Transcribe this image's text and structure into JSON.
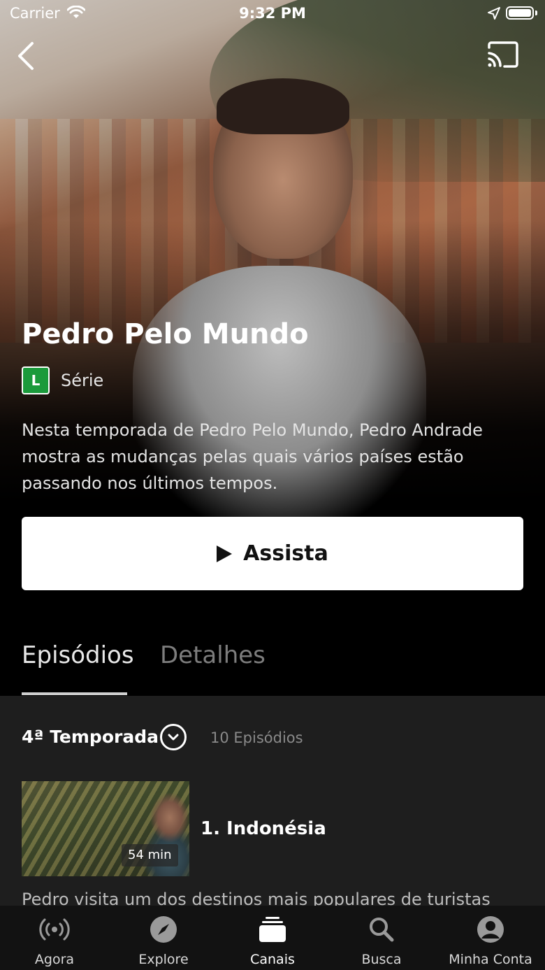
{
  "status_bar": {
    "carrier": "Carrier",
    "time": "9:32 PM"
  },
  "show": {
    "title": "Pedro Pelo Mundo",
    "rating": "L",
    "rating_color": "#1a9a3b",
    "type": "Série",
    "description": "Nesta temporada de Pedro Pelo Mundo, Pedro Andrade mostra as mudanças pelas quais vários países estão passando nos últimos tempos.",
    "watch_label": "Assista"
  },
  "tabs": {
    "episodes": "Episódios",
    "details": "Detalhes",
    "active": "episodes"
  },
  "season": {
    "label": "4ª Temporada",
    "episode_count": "10 Episódios"
  },
  "episodes": [
    {
      "title": "1. Indonésia",
      "duration": "54 min",
      "description": "Pedro visita um dos destinos mais populares de turistas"
    }
  ],
  "tab_bar": {
    "items": [
      {
        "label": "Agora",
        "icon": "broadcast-icon"
      },
      {
        "label": "Explore",
        "icon": "compass-icon"
      },
      {
        "label": "Canais",
        "icon": "channels-icon"
      },
      {
        "label": "Busca",
        "icon": "search-icon"
      },
      {
        "label": "Minha Conta",
        "icon": "account-icon"
      }
    ],
    "active": "Canais"
  }
}
